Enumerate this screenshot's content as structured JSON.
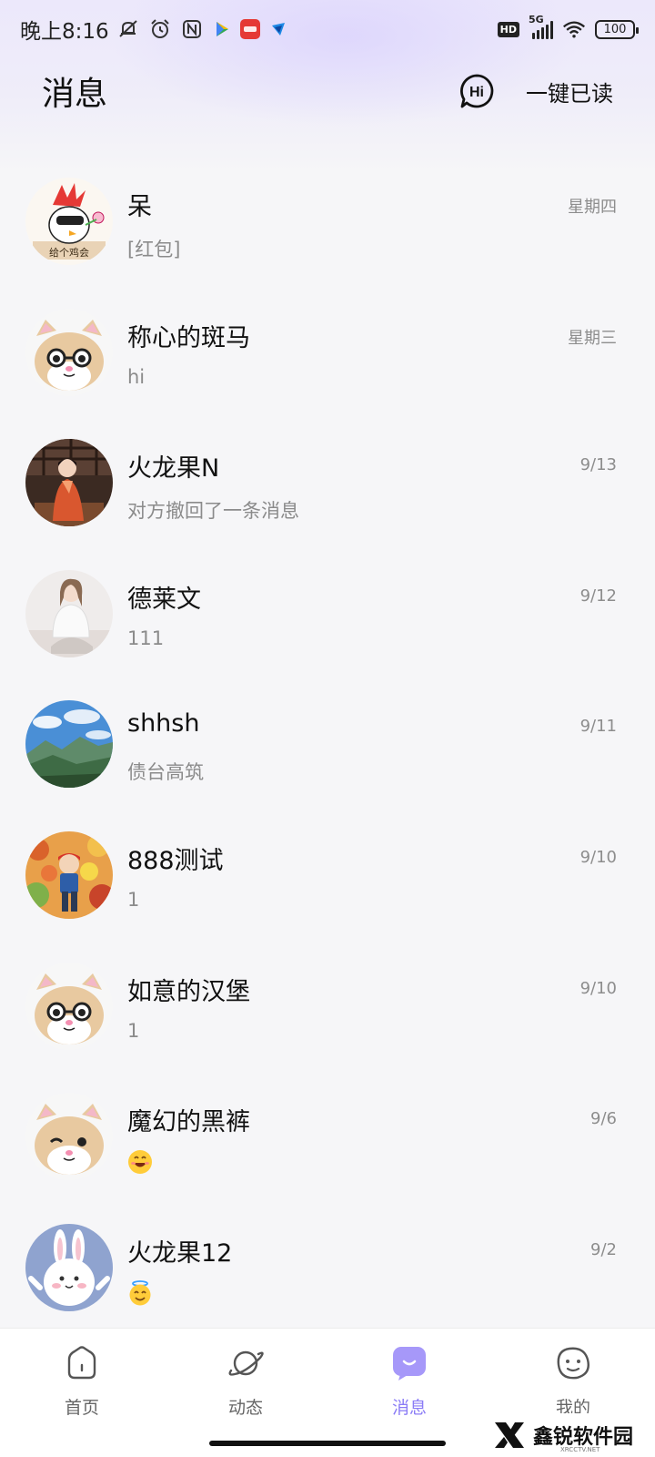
{
  "status_bar": {
    "time": "晚上8:16",
    "hd": "HD",
    "network": "5G",
    "battery": "100"
  },
  "header": {
    "title": "消息",
    "hi_icon": "Hi",
    "mark_all_read": "一键已读"
  },
  "conversations": [
    {
      "name": "呆",
      "preview": "[红包]",
      "time": "星期四",
      "avatar": "rooster-sticker"
    },
    {
      "name": "称心的斑马",
      "preview": "hi",
      "time": "星期三",
      "avatar": "hamster-glasses"
    },
    {
      "name": "火龙果N",
      "preview": "对方撤回了一条消息",
      "time": "9/13",
      "avatar": "photo-girl-red"
    },
    {
      "name": "德莱文",
      "preview": "111",
      "time": "9/12",
      "avatar": "photo-girl-white"
    },
    {
      "name": "shhsh",
      "preview": "债台高筑",
      "time": "9/11",
      "avatar": "photo-mountains"
    },
    {
      "name": "888测试",
      "preview": "1",
      "time": "9/10",
      "avatar": "anime-boy"
    },
    {
      "name": "如意的汉堡",
      "preview": "1",
      "time": "9/10",
      "avatar": "hamster-glasses"
    },
    {
      "name": "魔幻的黑裤",
      "preview": "",
      "preview_emoji": "grinning-emoji",
      "time": "9/6",
      "avatar": "hamster-wink"
    },
    {
      "name": "火龙果12",
      "preview": "",
      "preview_emoji": "angel-emoji",
      "time": "9/2",
      "avatar": "bunny-blue"
    }
  ],
  "bottom_nav": [
    {
      "label": "首页",
      "icon": "home-icon"
    },
    {
      "label": "动态",
      "icon": "planet-icon"
    },
    {
      "label": "消息",
      "icon": "message-icon",
      "active": true
    },
    {
      "label": "我的",
      "icon": "face-icon"
    }
  ],
  "watermark": {
    "text": "鑫锐软件园",
    "sub": "XRCCTV.NET"
  },
  "colors": {
    "accent": "#8b7cf6",
    "background": "#f6f6f8",
    "preview_text": "#8b8b8b"
  }
}
